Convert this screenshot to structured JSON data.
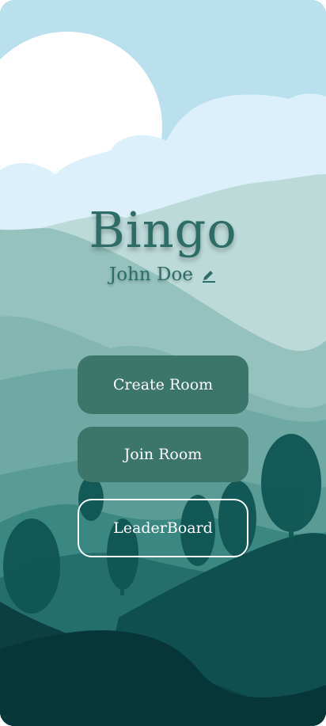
{
  "app": {
    "title": "Bingo",
    "username": "John Doe"
  },
  "menu": {
    "create_label": "Create Room",
    "join_label": "Join Room",
    "leaderboard_label": "LeaderBoard"
  },
  "icons": {
    "edit": "pencil-icon"
  },
  "colors": {
    "sky": "#b9e0ec",
    "accent": "#2e6d66",
    "button": "#3c756a",
    "button_text": "#ffffff"
  }
}
